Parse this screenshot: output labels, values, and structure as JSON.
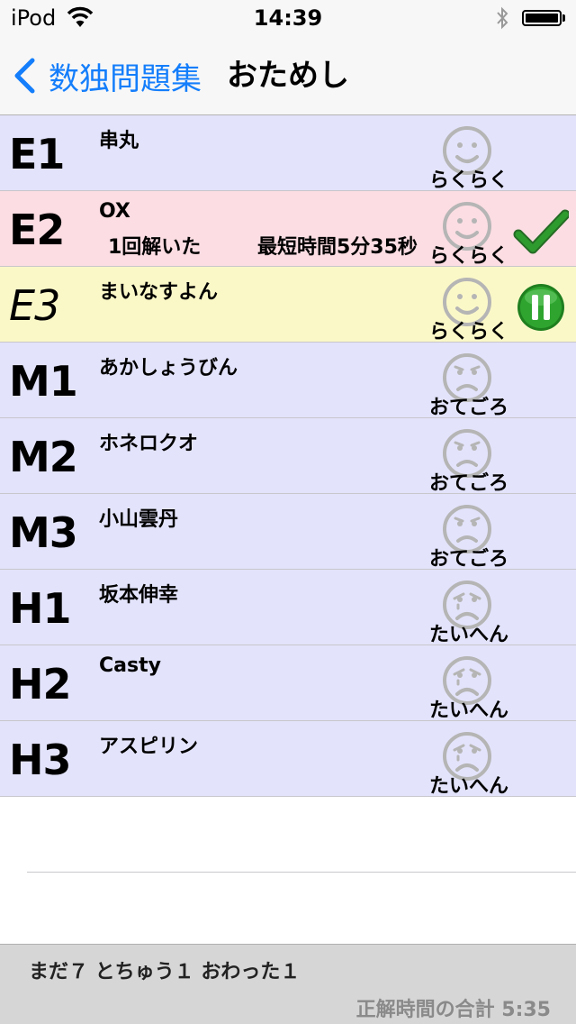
{
  "status_bar": {
    "carrier": "iPod",
    "time": "14:39",
    "battery_level": 1.0
  },
  "nav": {
    "back_label": "数独問題集",
    "title": "おためし"
  },
  "colors": {
    "easy_bg": "#e3e3fb",
    "solved_bg": "#fbdde3",
    "in_progress_bg": "#fbf8c8",
    "accent": "#147efb",
    "check": "#2e9b2e",
    "pause": "#2fa52f",
    "face": "#b5b5b5"
  },
  "puzzles": [
    {
      "code": "E1",
      "name": "串丸",
      "level": "らくらく",
      "face": "smile-face-icon",
      "status": "none",
      "bg": "#e3e3fb",
      "solved_text": "",
      "best_text": ""
    },
    {
      "code": "E2",
      "name": "OX",
      "level": "らくらく",
      "face": "smile-face-icon",
      "status": "solved",
      "bg": "#fbdde3",
      "solved_text": "1回解いた",
      "best_text": "最短時間5分35秒"
    },
    {
      "code": "E3",
      "name": "まいなすよん",
      "level": "らくらく",
      "face": "smile-face-icon",
      "status": "in-progress",
      "bg": "#fbf8c8",
      "solved_text": "",
      "best_text": ""
    },
    {
      "code": "M1",
      "name": "あかしょうびん",
      "level": "おてごろ",
      "face": "frown-face-icon",
      "status": "none",
      "bg": "#e3e3fb",
      "solved_text": "",
      "best_text": ""
    },
    {
      "code": "M2",
      "name": "ホネロクオ",
      "level": "おてごろ",
      "face": "frown-face-icon",
      "status": "none",
      "bg": "#e3e3fb",
      "solved_text": "",
      "best_text": ""
    },
    {
      "code": "M3",
      "name": "小山雲丹",
      "level": "おてごろ",
      "face": "frown-face-icon",
      "status": "none",
      "bg": "#e3e3fb",
      "solved_text": "",
      "best_text": ""
    },
    {
      "code": "H1",
      "name": "坂本伸幸",
      "level": "たいへん",
      "face": "crying-face-icon",
      "status": "none",
      "bg": "#e3e3fb",
      "solved_text": "",
      "best_text": ""
    },
    {
      "code": "H2",
      "name": "Casty",
      "level": "たいへん",
      "face": "crying-face-icon",
      "status": "none",
      "bg": "#e3e3fb",
      "solved_text": "",
      "best_text": ""
    },
    {
      "code": "H3",
      "name": "アスピリン",
      "level": "たいへん",
      "face": "crying-face-icon",
      "status": "none",
      "bg": "#e3e3fb",
      "solved_text": "",
      "best_text": ""
    }
  ],
  "footer": {
    "counts": "まだ７ とちゅう１ おわった１",
    "total": "正解時間の合計 5:35"
  }
}
